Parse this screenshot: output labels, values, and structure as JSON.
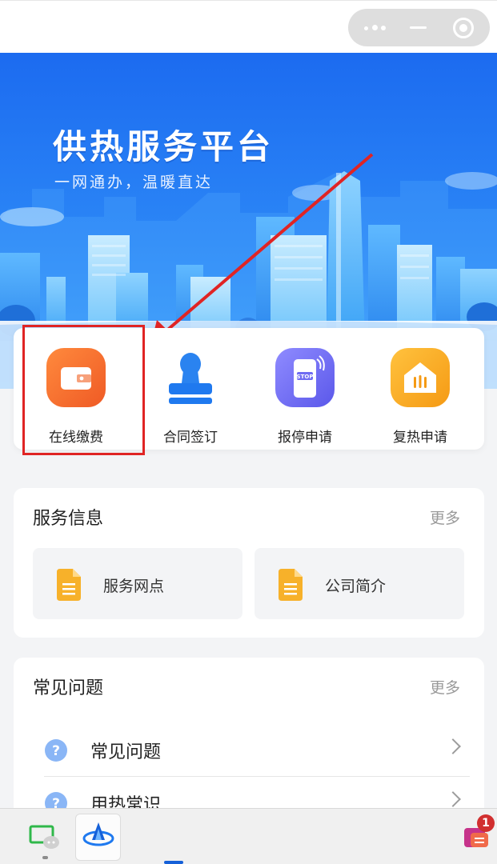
{
  "capsule": {
    "more_icon": "more-dots-icon",
    "minimize_icon": "minimize-icon",
    "close_icon": "target-close-icon"
  },
  "banner": {
    "title": "供热服务平台",
    "subtitle": "一网通办，温暖直达"
  },
  "quick_actions": [
    {
      "label": "在线缴费",
      "icon": "wallet-icon",
      "color": "#f26a2c"
    },
    {
      "label": "合同签订",
      "icon": "stamp-icon",
      "color": "#1f79ef"
    },
    {
      "label": "报停申请",
      "icon": "stop-phone-icon",
      "color": "#6f6cf2",
      "icon_text": "STOP"
    },
    {
      "label": "复热申请",
      "icon": "heating-house-icon",
      "color": "#f7a221"
    }
  ],
  "service_info": {
    "title": "服务信息",
    "more": "更多",
    "items": [
      {
        "label": "服务网点",
        "icon": "document-icon"
      },
      {
        "label": "公司简介",
        "icon": "document-icon"
      }
    ]
  },
  "faq": {
    "title": "常见问题",
    "more": "更多",
    "items": [
      {
        "label": "常见问题",
        "icon": "question-icon"
      },
      {
        "label": "用热常识",
        "icon": "question-icon"
      }
    ]
  },
  "taskbar": {
    "badge": "1"
  },
  "colors": {
    "accent": "#1f79ef",
    "highlight": "#e02424"
  }
}
